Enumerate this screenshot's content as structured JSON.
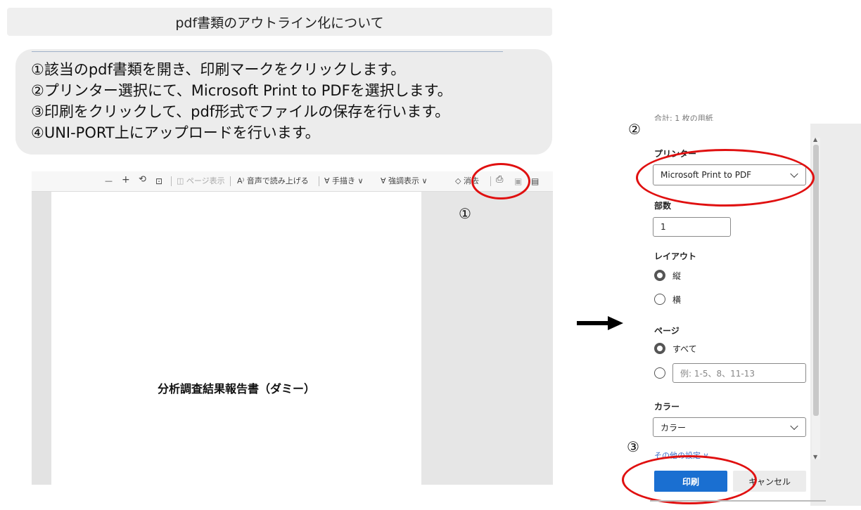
{
  "title": "pdf書類のアウトライン化について",
  "steps": [
    "①該当のpdf書類を開き、印刷マークをクリックします。",
    "②プリンター選択にて、Microsoft Print to PDFを選択します。",
    "③印刷をクリックして、pdf形式でファイルの保存を行います。",
    "④UNI-PORT上にアップロードを行います。"
  ],
  "viewer": {
    "toolbar": {
      "minus": "—",
      "plus": "+",
      "page_view": "ページ表示",
      "read_aloud": "音声で読み上げる",
      "draw": "手描き",
      "highlight": "強調表示",
      "erase": "消去"
    },
    "document_title": "分析調査結果報告書（ダミー）"
  },
  "markers": {
    "one": "①",
    "two": "②",
    "three": "③"
  },
  "print_panel": {
    "cut_header": "合計: 1 枚の用紙",
    "printer_label": "プリンター",
    "printer_value": "Microsoft Print to PDF",
    "copies_label": "部数",
    "copies_value": "1",
    "layout_label": "レイアウト",
    "layout_options": [
      "縦",
      "横"
    ],
    "pages_label": "ページ",
    "pages_all": "すべて",
    "pages_placeholder": "例: 1-5、8、11-13",
    "color_label": "カラー",
    "color_value": "カラー",
    "more_settings": "その他の設定 ∨",
    "print_button": "印刷",
    "cancel_button": "キャンセル"
  },
  "colors": {
    "accent": "#1a6fd1",
    "annotation": "#e01010"
  }
}
